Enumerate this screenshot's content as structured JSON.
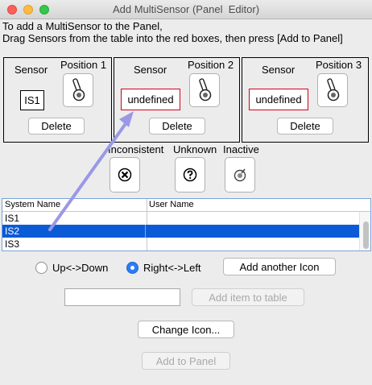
{
  "window": {
    "title": "Add MultiSensor (Panel  Editor)"
  },
  "instructions": {
    "line1": "To add a MultiSensor to the Panel,",
    "line2": "Drag Sensors from the table into the red boxes, then press [Add to Panel]"
  },
  "positions": [
    {
      "sensor_label": "Sensor",
      "position_label": "Position 1",
      "sensor_value": "IS1",
      "delete_label": "Delete",
      "icon": "sensor-icon"
    },
    {
      "sensor_label": "Sensor",
      "position_label": "Position 2",
      "sensor_value": "undefined",
      "delete_label": "Delete",
      "icon": "sensor-icon"
    },
    {
      "sensor_label": "Sensor",
      "position_label": "Position 3",
      "sensor_value": "undefined",
      "delete_label": "Delete",
      "icon": "sensor-icon"
    }
  ],
  "states": [
    {
      "label": "Inconsistent",
      "icon": "inconsistent-icon"
    },
    {
      "label": "Unknown",
      "icon": "unknown-icon"
    },
    {
      "label": "Inactive",
      "icon": "inactive-icon"
    }
  ],
  "table": {
    "columns": [
      "System Name",
      "User Name"
    ],
    "rows": [
      {
        "system_name": "IS1",
        "user_name": ""
      },
      {
        "system_name": "IS2",
        "user_name": ""
      },
      {
        "system_name": "IS3",
        "user_name": ""
      }
    ],
    "selected_row": 1
  },
  "orientation": {
    "option1": "Up<->Down",
    "option2": "Right<->Left",
    "selected": "Right<->Left"
  },
  "buttons": {
    "add_another_icon": "Add another Icon",
    "add_item_to_table": "Add item to table",
    "change_icon": "Change Icon...",
    "add_to_panel": "Add to Panel"
  },
  "new_item_field": {
    "value": ""
  },
  "colors": {
    "selection": "#0b5bd6",
    "required_box_border": "#d0021b",
    "drag_arrow": "#9b98e6"
  }
}
